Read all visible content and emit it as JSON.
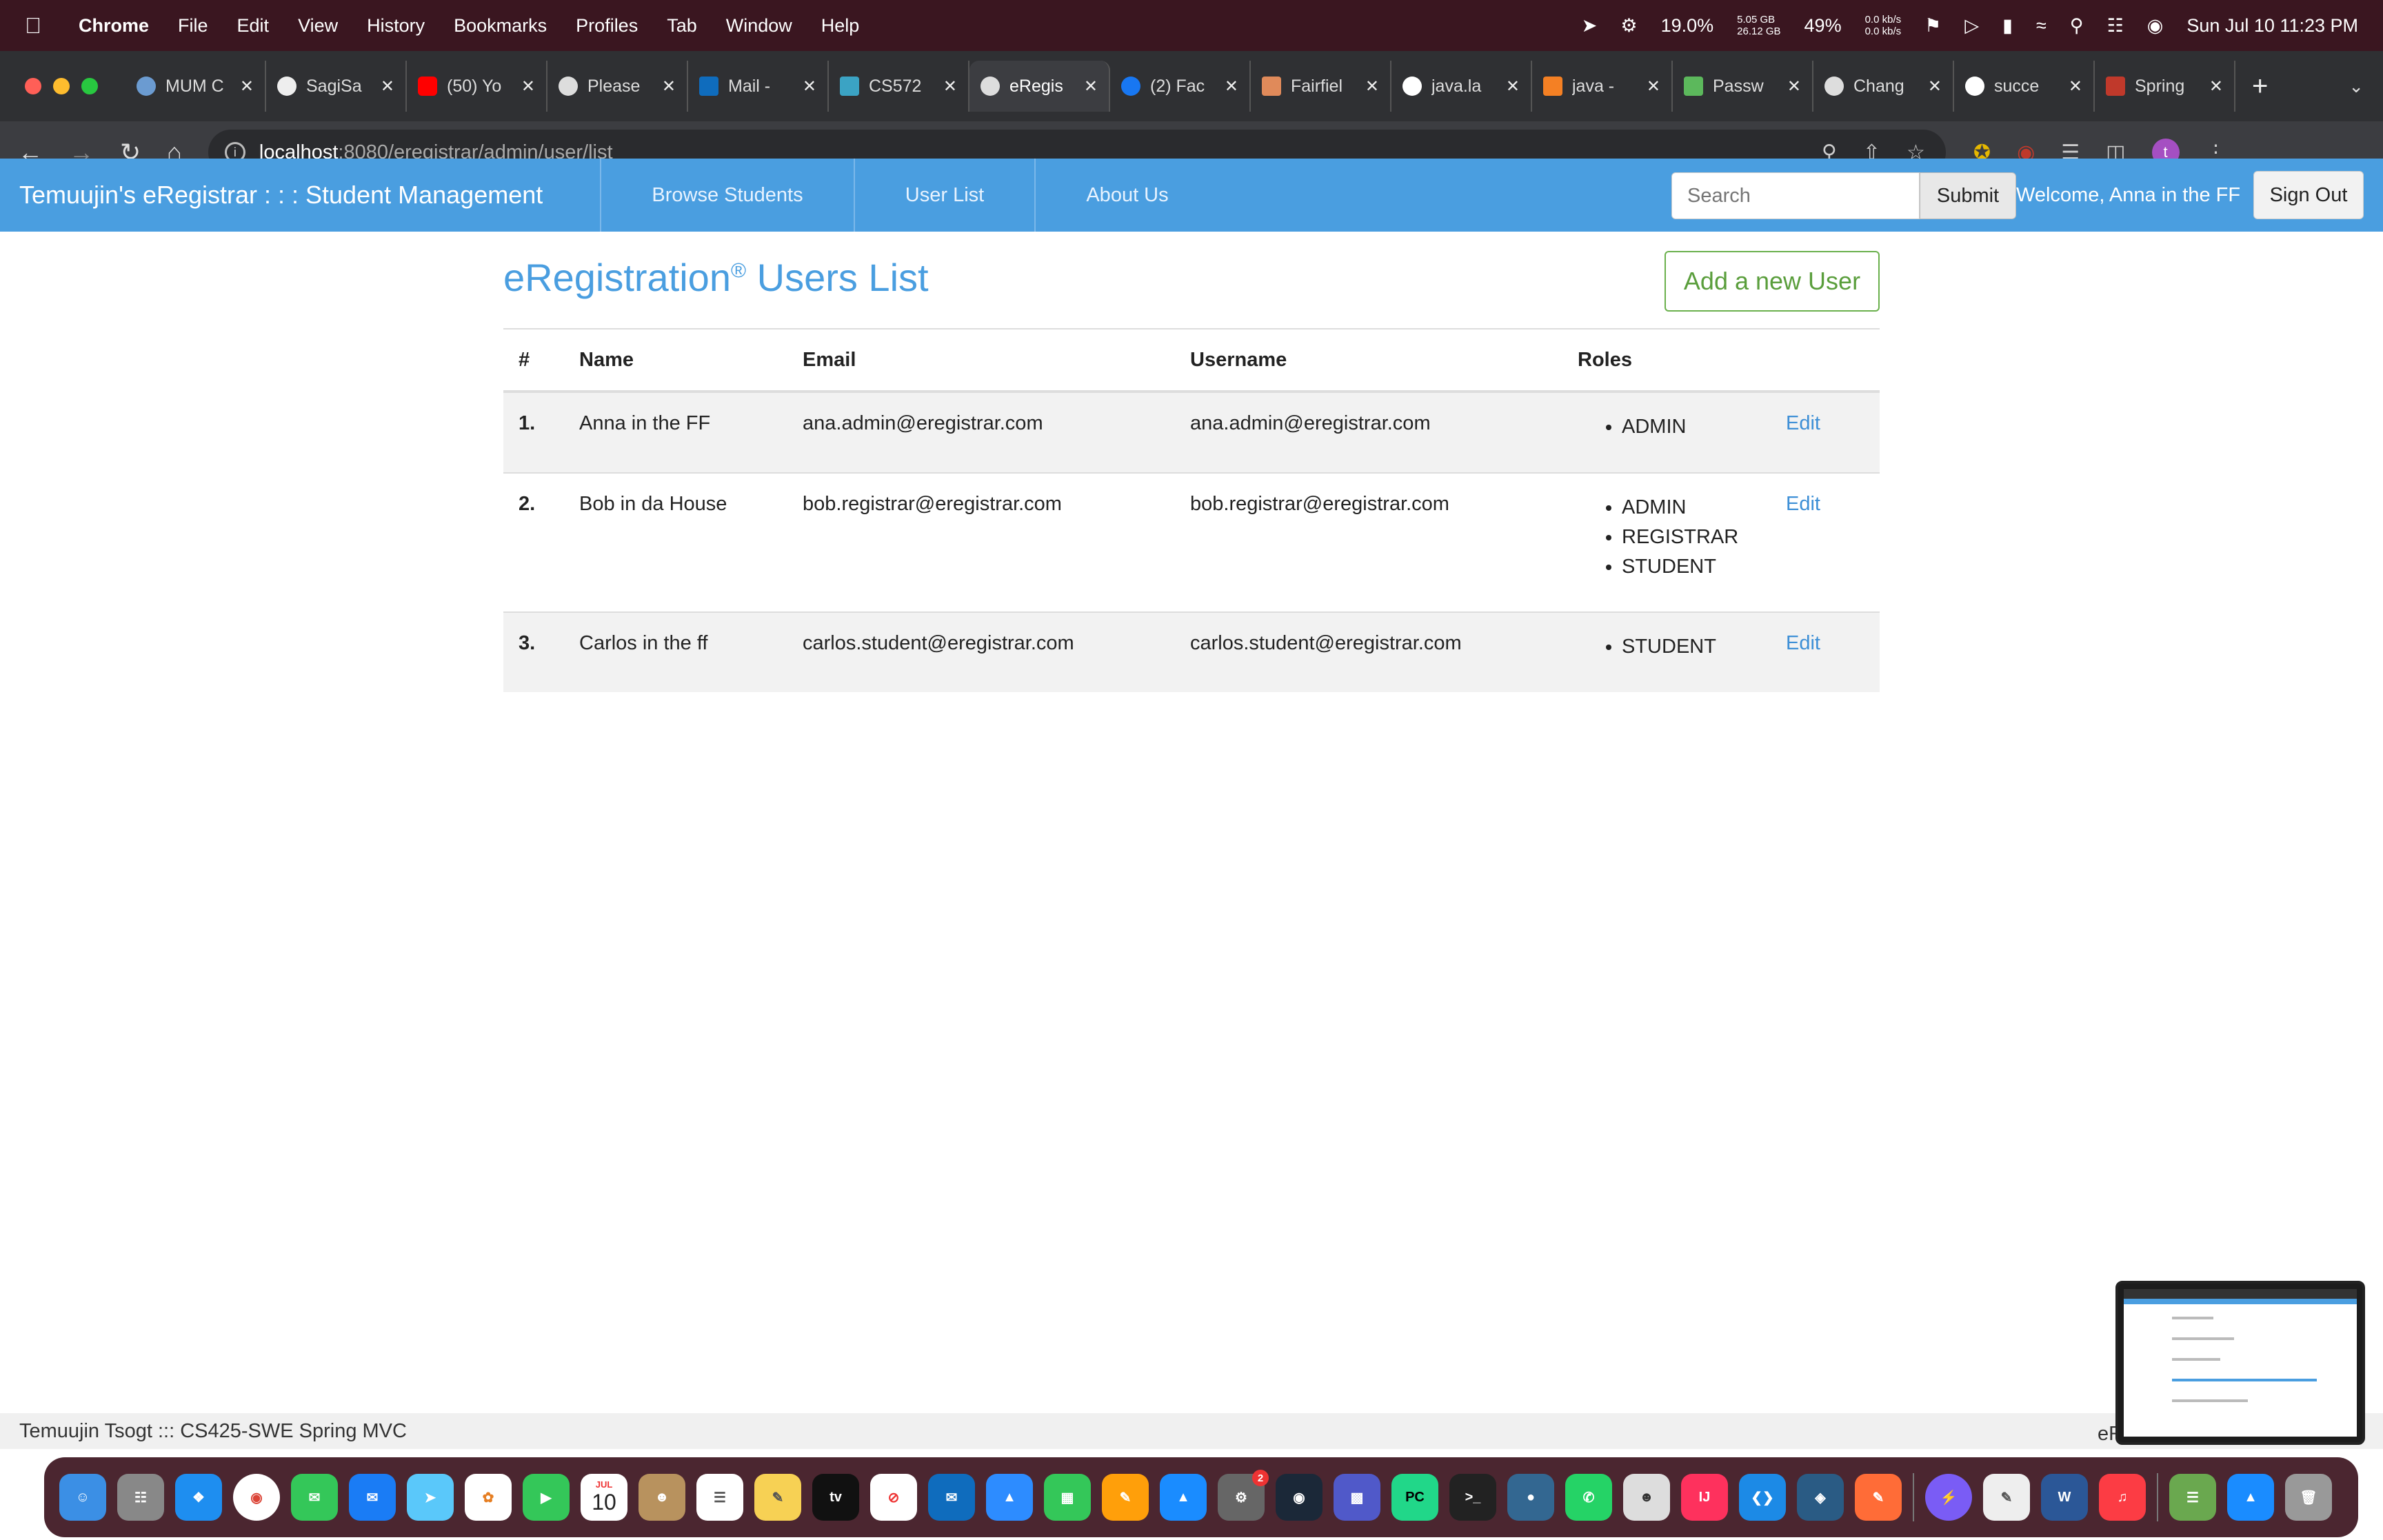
{
  "menubar": {
    "app": "Chrome",
    "items": [
      "File",
      "Edit",
      "View",
      "History",
      "Bookmarks",
      "Profiles",
      "Tab",
      "Window",
      "Help"
    ],
    "cpu": "19.0%",
    "mem_top": "5.05 GB",
    "mem_bottom": "26.12 GB",
    "battery": "49%",
    "net_up": "0.0 kb/s",
    "net_down": "0.0 kb/s",
    "datetime": "Sun Jul 10  11:23 PM"
  },
  "tabs": [
    {
      "title": "MUM C"
    },
    {
      "title": "SagiSa"
    },
    {
      "title": "(50) Yo"
    },
    {
      "title": "Please"
    },
    {
      "title": "Mail -"
    },
    {
      "title": "CS572"
    },
    {
      "title": "eRegis",
      "active": true
    },
    {
      "title": "(2) Fac"
    },
    {
      "title": "Fairfiel"
    },
    {
      "title": "java.la"
    },
    {
      "title": "java -"
    },
    {
      "title": "Passw"
    },
    {
      "title": "Chang"
    },
    {
      "title": "succe"
    },
    {
      "title": "Spring"
    }
  ],
  "address": {
    "host": "localhost",
    "path": ":8080/eregistrar/admin/user/list",
    "profile_initial": "t"
  },
  "appnav": {
    "brand": "Temuujin's eRegistrar : : : Student Management",
    "links": [
      "Browse Students",
      "User List",
      "About Us"
    ],
    "search_placeholder": "Search",
    "submit": "Submit",
    "welcome": "Welcome,  Anna in the FF",
    "signout": "Sign Out"
  },
  "page": {
    "title": "eRegistration",
    "title_mark": "®",
    "title_suffix": " Users List",
    "add_button": "Add a new User"
  },
  "table": {
    "headers": [
      "#",
      "Name",
      "Email",
      "Username",
      "Roles"
    ],
    "rows": [
      {
        "num": "1.",
        "name": "Anna in the FF",
        "email": "ana.admin@eregistrar.com",
        "username": "ana.admin@eregistrar.com",
        "roles": [
          "ADMIN"
        ],
        "action": "Edit"
      },
      {
        "num": "2.",
        "name": "Bob in da House",
        "email": "bob.registrar@eregistrar.com",
        "username": "bob.registrar@eregistrar.com",
        "roles": [
          "ADMIN",
          "REGISTRAR",
          "STUDENT"
        ],
        "action": "Edit"
      },
      {
        "num": "3.",
        "name": "Carlos in the ff",
        "email": "carlos.student@eregistrar.com",
        "username": "carlos.student@eregistrar.com",
        "roles": [
          "STUDENT"
        ],
        "action": "Edit"
      }
    ]
  },
  "footer": {
    "left": "Temuujin Tsogt ::: CS425-SWE Spring MVC",
    "right": "eR"
  },
  "dock": {
    "calendar_month": "JUL",
    "calendar_day": "10",
    "tv_label": "tv",
    "pc_label": "PC",
    "ij_label": "IJ",
    "badge": "2"
  },
  "colors": {
    "menubar_bg": "#3a1620",
    "nav_blue": "#4a9ee0",
    "add_green": "#6ab04c",
    "link_blue": "#3d8fd6"
  }
}
